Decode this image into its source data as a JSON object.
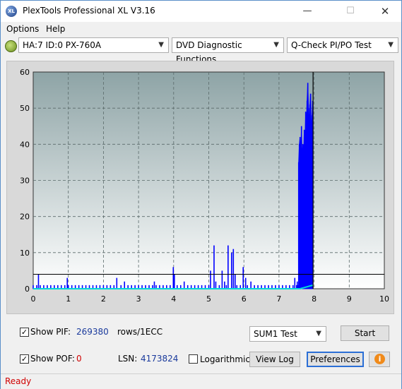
{
  "window": {
    "title": "PlexTools Professional XL V3.16",
    "app_icon_text": "XL"
  },
  "titlebar_buttons": {
    "minimize": "—",
    "maximize": "☐",
    "close": "✕"
  },
  "menu": [
    "Options",
    "Help"
  ],
  "toolbar": {
    "drive": "HA:7 ID:0  PX-760A",
    "function": "DVD Diagnostic Functions",
    "test": "Q-Check PI/PO Test"
  },
  "chart_data": {
    "type": "bar",
    "title": "",
    "xlabel": "",
    "ylabel": "",
    "xlim": [
      0,
      10
    ],
    "ylim": [
      0,
      60
    ],
    "x_ticks": [
      0,
      1,
      2,
      3,
      4,
      5,
      6,
      7,
      8,
      9,
      10
    ],
    "y_ticks": [
      0,
      10,
      20,
      30,
      40,
      50,
      60
    ],
    "grid": true,
    "threshold_line_y": 4,
    "end_marker_x": 7.97,
    "colors": {
      "pif": "#0000ff",
      "pof": "#00d8d8",
      "threshold": "#000000",
      "plot_bg_top": "#8ea4a6",
      "plot_bg_bottom": "#ffffff"
    },
    "series": [
      {
        "name": "PIF",
        "points": [
          [
            0.0,
            1
          ],
          [
            0.1,
            1
          ],
          [
            0.15,
            4
          ],
          [
            0.2,
            1
          ],
          [
            0.3,
            1
          ],
          [
            0.4,
            1
          ],
          [
            0.5,
            1
          ],
          [
            0.6,
            1
          ],
          [
            0.7,
            1
          ],
          [
            0.8,
            1
          ],
          [
            0.9,
            1
          ],
          [
            0.97,
            3
          ],
          [
            1.0,
            1
          ],
          [
            1.1,
            1
          ],
          [
            1.2,
            1
          ],
          [
            1.3,
            1
          ],
          [
            1.4,
            1
          ],
          [
            1.5,
            1
          ],
          [
            1.6,
            1
          ],
          [
            1.7,
            1
          ],
          [
            1.8,
            1
          ],
          [
            1.9,
            1
          ],
          [
            2.0,
            1
          ],
          [
            2.1,
            1
          ],
          [
            2.2,
            1
          ],
          [
            2.3,
            1
          ],
          [
            2.38,
            3
          ],
          [
            2.5,
            1
          ],
          [
            2.6,
            2
          ],
          [
            2.7,
            1
          ],
          [
            2.8,
            1
          ],
          [
            2.9,
            1
          ],
          [
            3.0,
            1
          ],
          [
            3.1,
            1
          ],
          [
            3.2,
            1
          ],
          [
            3.3,
            1
          ],
          [
            3.4,
            1
          ],
          [
            3.45,
            2
          ],
          [
            3.5,
            1
          ],
          [
            3.6,
            1
          ],
          [
            3.7,
            1
          ],
          [
            3.8,
            1
          ],
          [
            3.9,
            1
          ],
          [
            3.99,
            6
          ],
          [
            4.02,
            4
          ],
          [
            4.1,
            1
          ],
          [
            4.2,
            1
          ],
          [
            4.3,
            2
          ],
          [
            4.4,
            1
          ],
          [
            4.5,
            1
          ],
          [
            4.6,
            1
          ],
          [
            4.7,
            1
          ],
          [
            4.8,
            1
          ],
          [
            4.9,
            1
          ],
          [
            5.0,
            1
          ],
          [
            5.05,
            5
          ],
          [
            5.15,
            12
          ],
          [
            5.2,
            2
          ],
          [
            5.3,
            1
          ],
          [
            5.38,
            5
          ],
          [
            5.45,
            2
          ],
          [
            5.5,
            1
          ],
          [
            5.55,
            12
          ],
          [
            5.65,
            10
          ],
          [
            5.7,
            11
          ],
          [
            5.75,
            4
          ],
          [
            5.8,
            1
          ],
          [
            5.9,
            1
          ],
          [
            5.98,
            6
          ],
          [
            6.05,
            3
          ],
          [
            6.1,
            1
          ],
          [
            6.2,
            2
          ],
          [
            6.3,
            1
          ],
          [
            6.4,
            1
          ],
          [
            6.5,
            1
          ],
          [
            6.6,
            1
          ],
          [
            6.7,
            1
          ],
          [
            6.8,
            1
          ],
          [
            6.9,
            1
          ],
          [
            7.0,
            1
          ],
          [
            7.1,
            1
          ],
          [
            7.2,
            1
          ],
          [
            7.3,
            1
          ],
          [
            7.4,
            1
          ],
          [
            7.45,
            3
          ],
          [
            7.5,
            1
          ],
          [
            7.52,
            2
          ],
          [
            7.54,
            1
          ],
          [
            7.56,
            35
          ],
          [
            7.58,
            40
          ],
          [
            7.6,
            42
          ],
          [
            7.62,
            38
          ],
          [
            7.64,
            45
          ],
          [
            7.66,
            36
          ],
          [
            7.68,
            40
          ],
          [
            7.7,
            38
          ],
          [
            7.72,
            44
          ],
          [
            7.74,
            41
          ],
          [
            7.76,
            49
          ],
          [
            7.78,
            46
          ],
          [
            7.8,
            52
          ],
          [
            7.82,
            57
          ],
          [
            7.84,
            50
          ],
          [
            7.86,
            46
          ],
          [
            7.88,
            51
          ],
          [
            7.9,
            54
          ],
          [
            7.92,
            43
          ],
          [
            7.94,
            48
          ],
          [
            7.96,
            52
          ]
        ]
      },
      {
        "name": "POF",
        "points": [
          [
            0.0,
            0
          ],
          [
            7.6,
            0
          ],
          [
            7.97,
            1
          ]
        ]
      }
    ]
  },
  "controls": {
    "show_pif_label": "Show PIF:",
    "show_pif_checked": true,
    "pif_value": "269380",
    "pif_unit": "rows/1ECC",
    "show_pof_label": "Show POF:",
    "show_pof_checked": true,
    "pof_value": "0",
    "lsn_label": "LSN:",
    "lsn_value": "4173824",
    "logarithmic_label": "Logarithmic",
    "logarithmic_checked": false,
    "test_select": "SUM1 Test",
    "start_button": "Start",
    "view_log_button": "View Log",
    "preferences_button": "Preferences",
    "info_icon": "i"
  },
  "status": {
    "text": "Ready"
  }
}
